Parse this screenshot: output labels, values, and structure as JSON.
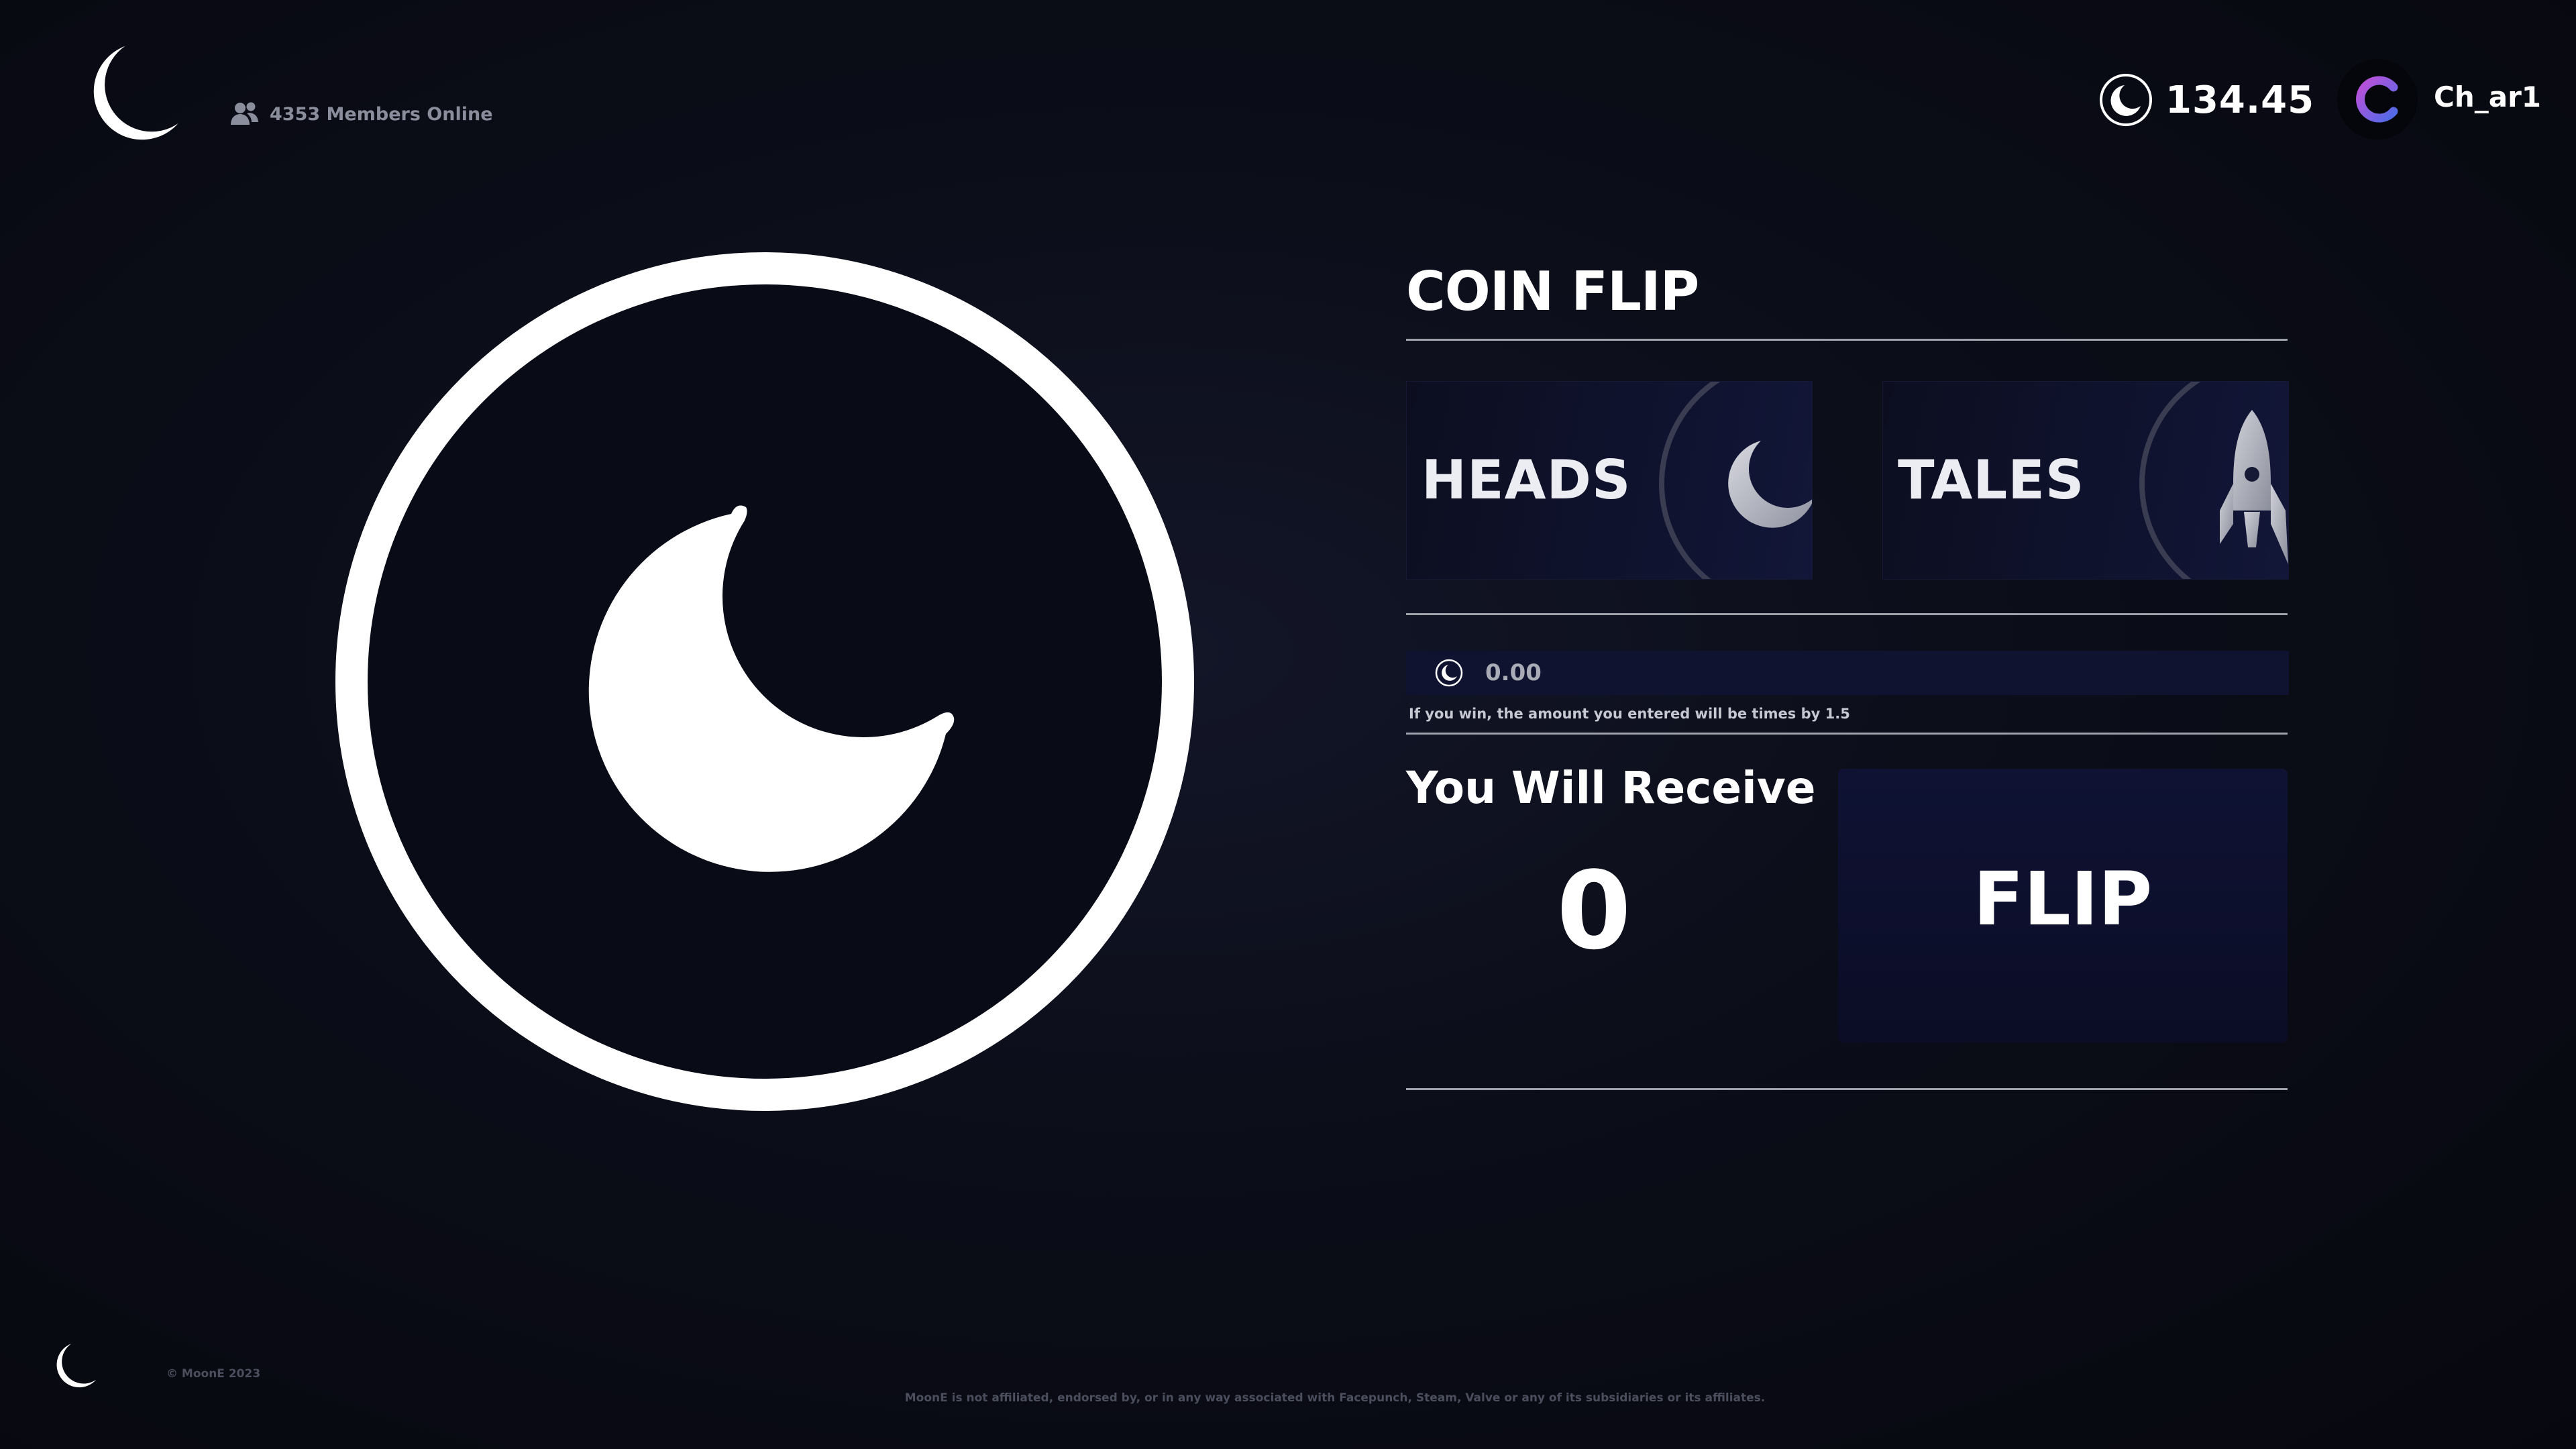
{
  "colors": {
    "background": "#07080f",
    "panel": "#101330",
    "text": "#ffffff",
    "muted": "#8a8e9c",
    "accent_avatar": "#9b4de0"
  },
  "header": {
    "logo_icon": "moon-icon",
    "members_icon": "users-icon",
    "members_online": "4353 Members Online",
    "balance_icon": "moon-coin-icon",
    "balance": "134.45",
    "username": "Ch_ar1"
  },
  "coin": {
    "icon": "moon-icon"
  },
  "game": {
    "title": "COIN FLIP",
    "options": [
      {
        "label": "HEADS",
        "icon": "moon-icon"
      },
      {
        "label": "TALES",
        "icon": "rocket-icon"
      }
    ],
    "amount": {
      "icon": "moon-coin-icon",
      "value": "",
      "placeholder": "0.00"
    },
    "hint": "If you win, the amount you entered will be times by 1.5",
    "receive_label": "You Will Receive",
    "receive_value": "0",
    "flip_label": "FLIP"
  },
  "footer": {
    "logo_icon": "moon-icon",
    "copyright": "© MoonE 2023",
    "disclaimer": "MoonE  is not affiliated, endorsed by, or in any way associated with  Facepunch, Steam, Valve or any of its subsidiaries or its affiliates."
  }
}
